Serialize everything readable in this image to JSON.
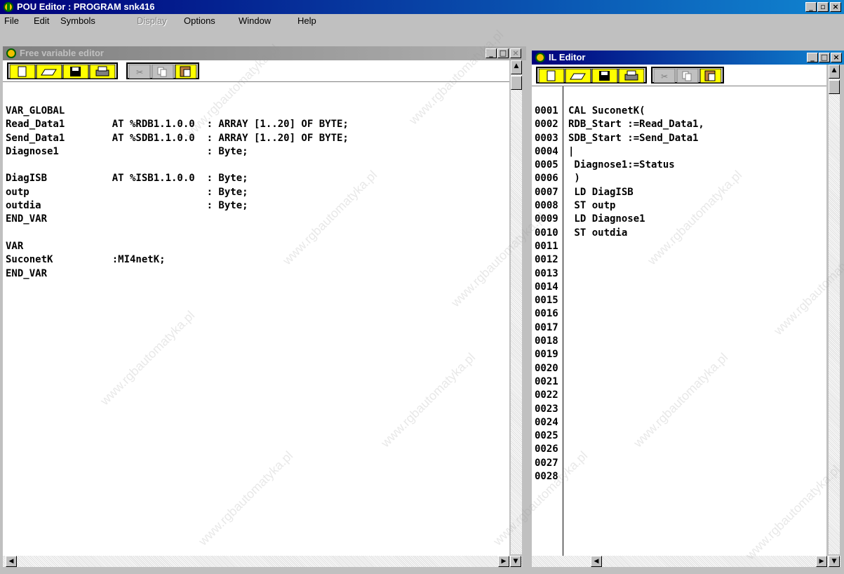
{
  "app": {
    "title": "POU Editor : PROGRAM snk416"
  },
  "menu": {
    "file": "File",
    "edit": "Edit",
    "symbols": "Symbols",
    "display": "Display",
    "options": "Options",
    "window": "Window",
    "help": "Help"
  },
  "left_window": {
    "title": "Free variable editor",
    "code": "VAR_GLOBAL\nRead_Data1        AT %RDB1.1.0.0  : ARRAY [1..20] OF BYTE;\nSend_Data1        AT %SDB1.1.0.0  : ARRAY [1..20] OF BYTE;\nDiagnose1                         : Byte;\n\nDiagISB           AT %ISB1.1.0.0  : Byte;\noutp                              : Byte;\noutdia                            : Byte;\nEND_VAR\n\nVAR\nSuconetK          :MI4netK;\nEND_VAR"
  },
  "right_window": {
    "title": "IL Editor",
    "line_numbers": "0001\n0002\n0003\n0004\n0005\n0006\n0007\n0008\n0009\n0010\n0011\n0012\n0013\n0014\n0015\n0016\n0017\n0018\n0019\n0020\n0021\n0022\n0023\n0024\n0025\n0026\n0027\n0028",
    "code": "CAL SuconetK(\nRDB_Start :=Read_Data1,\nSDB_Start :=Send_Data1\n|\n Diagnose1:=Status\n )\n LD DiagISB\n ST outp\n LD Diagnose1\n ST outdia"
  },
  "watermark": "www.rgbautomatyka.pl"
}
